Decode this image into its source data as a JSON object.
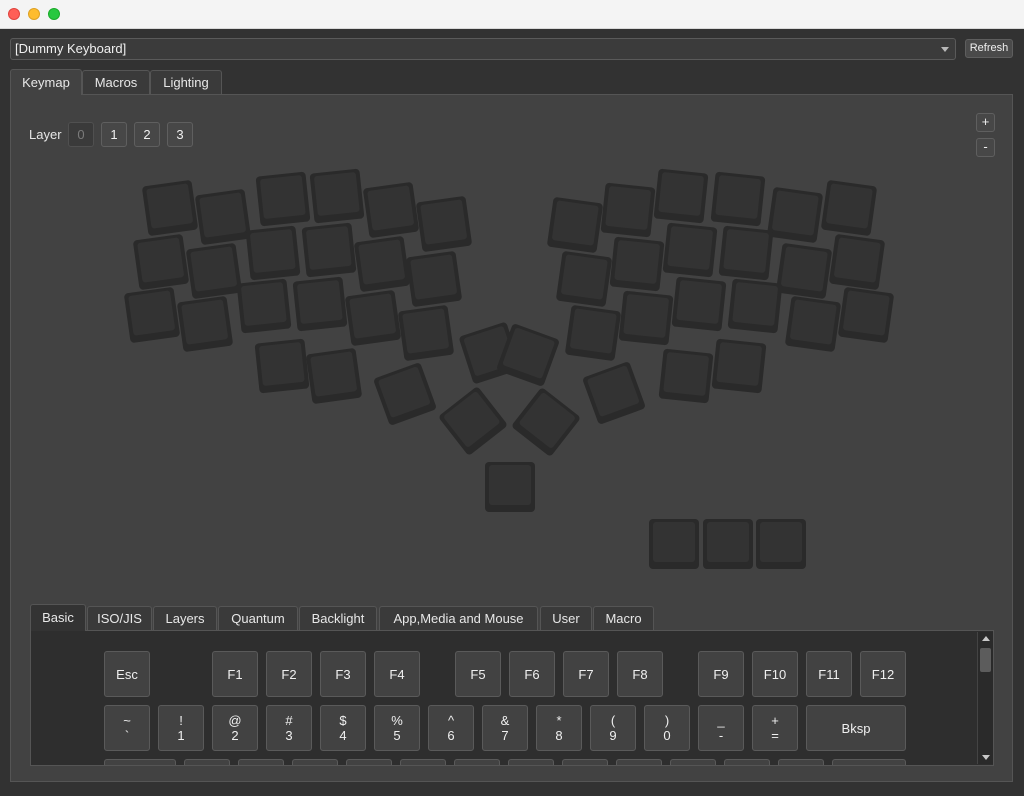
{
  "toolbar": {
    "keyboard_select_value": "[Dummy Keyboard]",
    "refresh_label": "Refresh"
  },
  "main_tabs": [
    {
      "label": "Keymap",
      "active": true
    },
    {
      "label": "Macros",
      "active": false
    },
    {
      "label": "Lighting",
      "active": false
    }
  ],
  "layers": {
    "label": "Layer",
    "buttons": [
      "0",
      "1",
      "2",
      "3"
    ],
    "active": "0"
  },
  "zoom": {
    "plus": "+",
    "minus": "-"
  },
  "keycode_tabs": [
    {
      "label": "Basic",
      "active": true
    },
    {
      "label": "ISO/JIS",
      "active": false
    },
    {
      "label": "Layers",
      "active": false
    },
    {
      "label": "Quantum",
      "active": false
    },
    {
      "label": "Backlight",
      "active": false
    },
    {
      "label": "App,Media and Mouse",
      "active": false
    },
    {
      "label": "User",
      "active": false
    },
    {
      "label": "Macro",
      "active": false
    }
  ],
  "basic_keys": {
    "row1": [
      "Esc",
      "F1",
      "F2",
      "F3",
      "F4",
      "F5",
      "F6",
      "F7",
      "F8",
      "F9",
      "F10",
      "F11",
      "F12"
    ],
    "row2": [
      {
        "top": "~",
        "bottom": "`"
      },
      {
        "top": "!",
        "bottom": "1"
      },
      {
        "top": "@",
        "bottom": "2"
      },
      {
        "top": "#",
        "bottom": "3"
      },
      {
        "top": "$",
        "bottom": "4"
      },
      {
        "top": "%",
        "bottom": "5"
      },
      {
        "top": "^",
        "bottom": "6"
      },
      {
        "top": "&",
        "bottom": "7"
      },
      {
        "top": "*",
        "bottom": "8"
      },
      {
        "top": "(",
        "bottom": "9"
      },
      {
        "top": ")",
        "bottom": "0"
      },
      {
        "top": "_",
        "bottom": "-"
      },
      {
        "top": "+",
        "bottom": "="
      },
      {
        "top": "",
        "bottom": "Bksp"
      }
    ]
  },
  "colors": {
    "window_bg": "#323232",
    "panel_bg": "#424242",
    "key_cap": "#333333",
    "key_border": "#2a2a2a"
  }
}
